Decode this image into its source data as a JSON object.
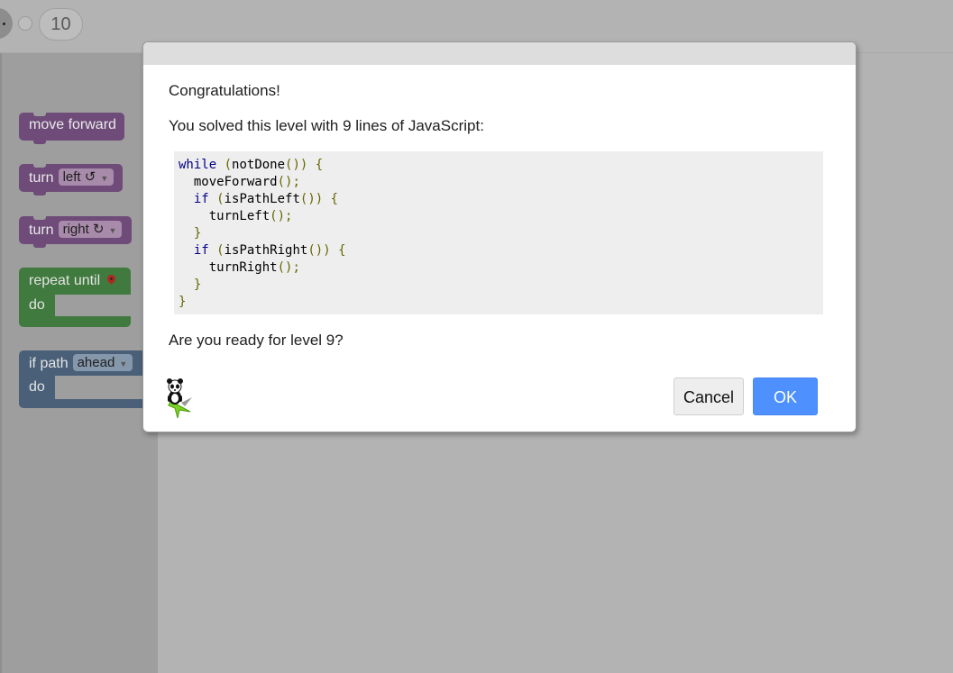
{
  "level_bar": {
    "current_level": "10"
  },
  "toolbox": {
    "blocks": [
      {
        "kind": "move",
        "label": "move forward"
      },
      {
        "kind": "turn",
        "label": "turn",
        "option": "left ↺"
      },
      {
        "kind": "turn",
        "label": "turn",
        "option": "right ↻"
      },
      {
        "kind": "repeat",
        "label": "repeat until",
        "do_label": "do",
        "icon": "map-marker-icon"
      },
      {
        "kind": "if",
        "label": "if path",
        "option": "ahead",
        "do_label": "do"
      }
    ],
    "colors": {
      "motion": "#6e4b78",
      "loop": "#407a3e",
      "logic": "#4a6078"
    }
  },
  "dialog": {
    "congrats": "Congratulations!",
    "solved_text": "You solved this level with 9 lines of JavaScript:",
    "code_lines": [
      "while (notDone()) {",
      "  moveForward();",
      "  if (isPathLeft()) {",
      "    turnLeft();",
      "  }",
      "  if (isPathRight()) {",
      "    turnRight();",
      "  }",
      "}"
    ],
    "question": "Are you ready for level 9?",
    "cancel_label": "Cancel",
    "ok_label": "OK",
    "mascot": "panda-on-arrow-icon",
    "ok_color": "#4d90fe"
  }
}
